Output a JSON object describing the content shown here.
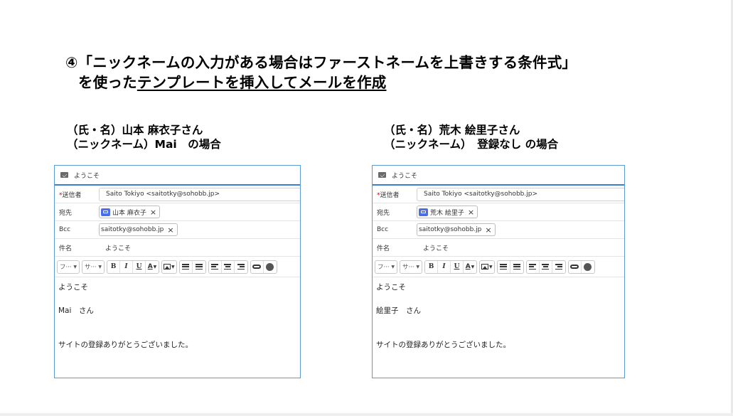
{
  "heading": {
    "line1": "④「ニックネームの入力がある場合はファーストネームを上書きする条件式」",
    "line2_prefix": "を使った",
    "line2_underlined": "テンプレートを挿入してメールを作成"
  },
  "cases": [
    {
      "title_line1": "（氏・名）山本 麻衣子さん",
      "title_line2": "（ニックネーム）Mai　の場合",
      "email": {
        "header_title": "ようこそ",
        "sender_label": "送信者",
        "required_mark": "*",
        "sender_value": "Saito Tokiyo <saitotky@sohobb.jp>",
        "to_label": "宛先",
        "to_value": "山本 麻衣子",
        "bcc_label": "Bcc",
        "bcc_value": "saitotky@sohobb.jp",
        "subject_label": "件名",
        "subject_value": "ようこそ",
        "font_select": "フ···",
        "size_select": "サ···",
        "body_greeting": "ようこそ",
        "body_name": "Mai　さん",
        "body_message": "サイトの登録ありがとうございました。"
      }
    },
    {
      "title_line1": "（氏・名）荒木 絵里子さん",
      "title_line2": "（ニックネーム）　登録なし の場合",
      "email": {
        "header_title": "ようこそ",
        "sender_label": "送信者",
        "required_mark": "*",
        "sender_value": "Saito Tokiyo <saitotky@sohobb.jp>",
        "to_label": "宛先",
        "to_value": "荒木 絵里子",
        "bcc_label": "Bcc",
        "bcc_value": "saitotky@sohobb.jp",
        "subject_label": "件名",
        "subject_value": "ようこそ",
        "font_select": "フ···",
        "size_select": "サ···",
        "body_greeting": "ようこそ",
        "body_name": "絵里子　さん",
        "body_message": "サイトの登録ありがとうございました。"
      }
    }
  ],
  "toolbar": {
    "bold": "B",
    "italic": "I",
    "underline": "U",
    "text_color": "A",
    "remove": "×"
  },
  "icons": [
    "mail-icon",
    "contact-icon",
    "close-icon",
    "image-icon",
    "numbered-list-icon",
    "bullet-list-icon",
    "align-left-icon",
    "align-center-icon",
    "align-right-icon",
    "link-icon",
    "emoji-icon"
  ],
  "colors": {
    "panel_border": "#5b9bd5",
    "header_rule": "#3a7fd0",
    "contact_badge": "#4a6fe8",
    "required": "#cc0000"
  }
}
